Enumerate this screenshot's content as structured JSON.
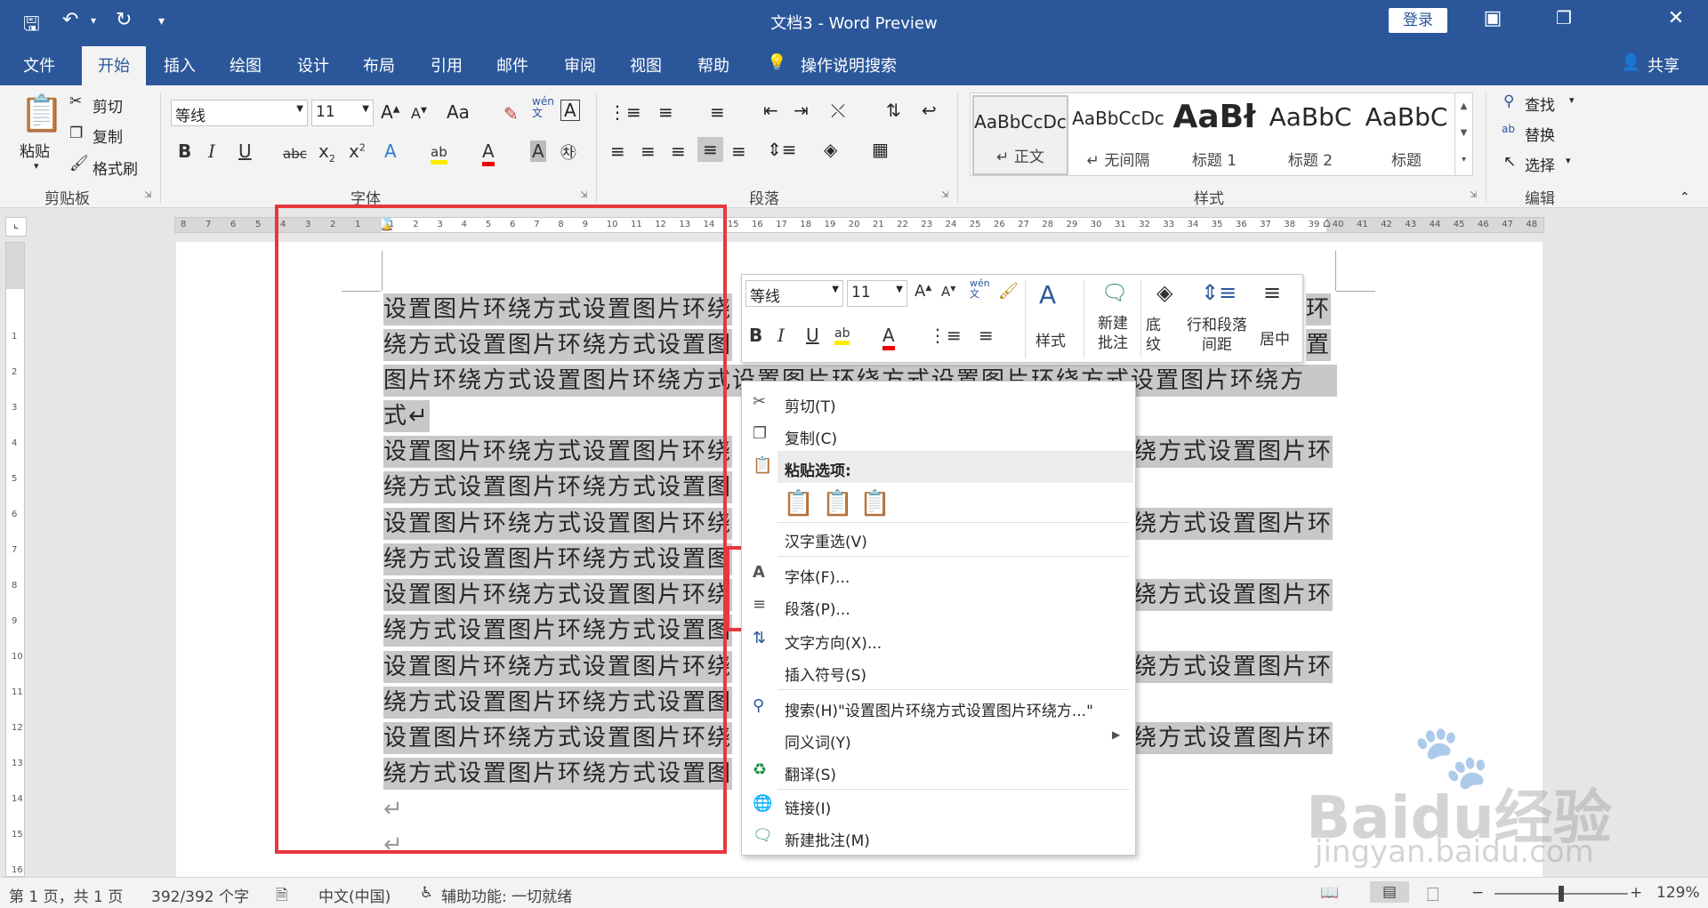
{
  "window": {
    "title": "文档3  -  Word Preview",
    "login": "登录",
    "quick_access": [
      "save-icon",
      "undo-icon",
      "redo-icon",
      "customize-icon"
    ]
  },
  "tabs": [
    "文件",
    "开始",
    "插入",
    "绘图",
    "设计",
    "布局",
    "引用",
    "邮件",
    "审阅",
    "视图",
    "帮助"
  ],
  "active_tab": "开始",
  "tell_me": "操作说明搜索",
  "share": "共享",
  "ribbon": {
    "clipboard": {
      "paste": "粘贴",
      "cut": "剪切",
      "copy": "复制",
      "format_painter": "格式刷",
      "label": "剪贴板"
    },
    "font": {
      "font_name": "等线",
      "font_size": "11",
      "label": "字体",
      "change_case": "Aa",
      "phonetic": "wén\n文"
    },
    "paragraph": {
      "label": "段落"
    },
    "styles": {
      "label": "样式",
      "items": [
        {
          "sample": "AaBbCcDc",
          "name": "↵ 正文"
        },
        {
          "sample": "AaBbCcDc",
          "name": "↵ 无间隔"
        },
        {
          "sample": "AaBł",
          "name": "标题 1"
        },
        {
          "sample": "AaBbC",
          "name": "标题 2"
        },
        {
          "sample": "AaBbC",
          "name": "标题"
        }
      ]
    },
    "editing": {
      "find": "查找",
      "replace": "替换",
      "select": "选择",
      "label": "编辑"
    }
  },
  "document": {
    "lines": [
      {
        "left": "设置图片环绕方式设置图片环绕",
        "right": "环",
        "hl": true
      },
      {
        "left": "绕方式设置图片环绕方式设置图",
        "right": "置",
        "hl": true
      },
      {
        "left": "图片环绕方式设置图片环绕方式设置图片环绕方式设置图片环绕方式设置图片环绕方",
        "right": "",
        "hl": true
      },
      {
        "left": "式↵",
        "right": "",
        "hl": true
      },
      {
        "left": "设置图片环绕方式设置图片环绕",
        "right": "绕方式设置图片环",
        "hl": true
      },
      {
        "left": "绕方式设置图片环绕方式设置图",
        "right": "",
        "hl": true
      },
      {
        "left": "设置图片环绕方式设置图片环绕",
        "right": "绕方式设置图片环",
        "hl": true
      },
      {
        "left": "绕方式设置图片环绕方式设置图",
        "right": "",
        "hl": true
      },
      {
        "left": "设置图片环绕方式设置图片环绕",
        "right": "绕方式设置图片环",
        "hl": true
      },
      {
        "left": "绕方式设置图片环绕方式设置图",
        "right": "",
        "hl": true
      },
      {
        "left": "设置图片环绕方式设置图片环绕",
        "right": "绕方式设置图片环",
        "hl": true
      },
      {
        "left": "绕方式设置图片环绕方式设置图",
        "right": "",
        "hl": true
      },
      {
        "left": "设置图片环绕方式设置图片环绕",
        "right": "绕方式设置图片环",
        "hl": true
      },
      {
        "left": "绕方式设置图片环绕方式设置图",
        "right": "",
        "hl": true
      },
      {
        "left": "↵",
        "right": "",
        "hl": false
      },
      {
        "left": "↵",
        "right": "",
        "hl": false
      }
    ]
  },
  "mini_toolbar": {
    "font_name": "等线",
    "font_size": "11",
    "styles": "样式",
    "new_comment": "新建\n批注",
    "shading": "底\n纹",
    "line_spacing": "行和段落\n间距",
    "center": "居中"
  },
  "context_menu": {
    "items": [
      {
        "label": "剪切(T)",
        "icon": "scissors-icon"
      },
      {
        "label": "复制(C)",
        "icon": "copy-icon"
      },
      {
        "label": "粘贴选项:",
        "icon": "clipboard-icon"
      },
      {
        "label": "汉字重选(V)",
        "icon": ""
      },
      {
        "label": "字体(F)...",
        "icon": "font-a-icon"
      },
      {
        "label": "段落(P)...",
        "icon": "paragraph-icon"
      },
      {
        "label": "文字方向(X)...",
        "icon": "text-direction-icon"
      },
      {
        "label": "插入符号(S)",
        "icon": ""
      },
      {
        "label": "搜索(H)\"设置图片环绕方式设置图片环绕方...\"",
        "icon": "search-icon"
      },
      {
        "label": "同义词(Y)",
        "icon": ""
      },
      {
        "label": "翻译(S)",
        "icon": "translate-icon"
      },
      {
        "label": "链接(I)",
        "icon": "link-icon"
      },
      {
        "label": "新建批注(M)",
        "icon": "new-comment-icon"
      }
    ]
  },
  "status": {
    "page": "第 1 页，共 1 页",
    "words": "392/392 个字",
    "language": "中文(中国)",
    "accessibility": "辅助功能: 一切就绪",
    "zoom": "129%"
  },
  "watermark": {
    "brand": "Baidu经验",
    "url": "jingyan.baidu.com"
  },
  "colors": {
    "brand": "#2b579a",
    "highlight": "#c8c8c8",
    "annotation": "#e8383d"
  }
}
